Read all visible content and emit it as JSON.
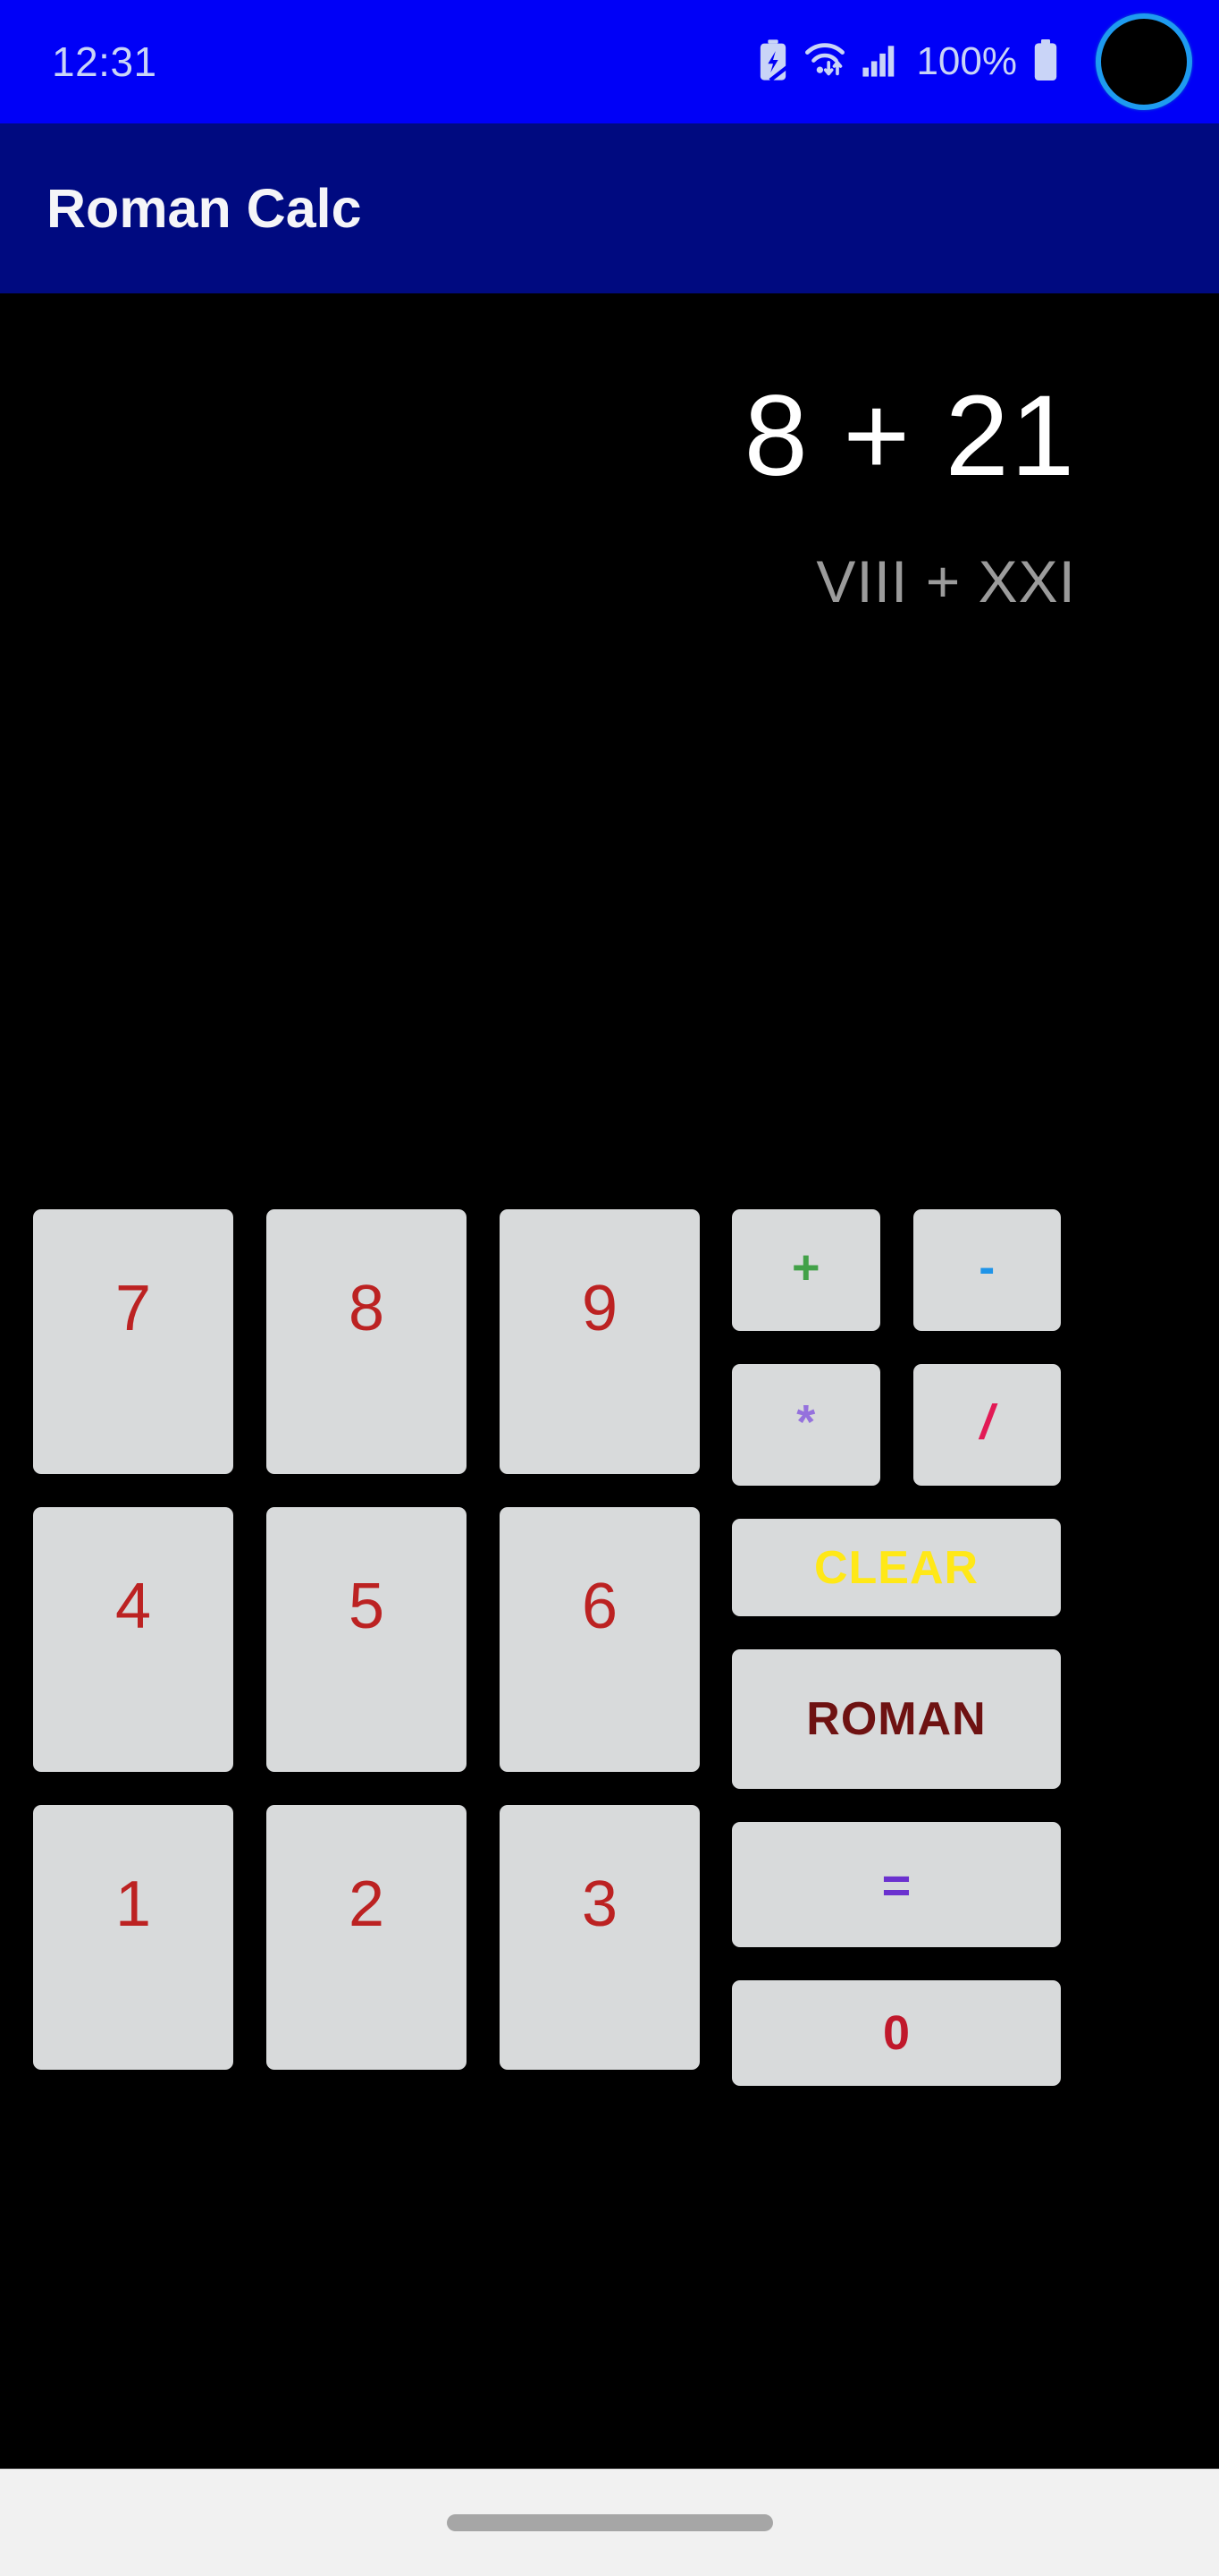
{
  "status_bar": {
    "time": "12:31",
    "battery_percent": "100%",
    "icons": [
      "battery-saver-icon",
      "wifi-data-icon",
      "cellular-signal-icon",
      "battery-icon"
    ],
    "background_color": "#0000f7",
    "text_color": "#c9d4f7",
    "punch_hole_ring_color": "#1e9bf0"
  },
  "app_bar": {
    "title": "Roman Calc",
    "background_color": "#000a80",
    "title_color": "#f5f5f8"
  },
  "display": {
    "primary": "8 + 21",
    "secondary": "VIII + XXI",
    "primary_color": "#ffffff",
    "secondary_color": "#9b9b9b",
    "background_color": "#000000"
  },
  "keypad": {
    "button_background": "#d8dadb",
    "digits": [
      {
        "label": "7",
        "name": "key-7",
        "color": "#bc2222"
      },
      {
        "label": "8",
        "name": "key-8",
        "color": "#bc2222"
      },
      {
        "label": "9",
        "name": "key-9",
        "color": "#bc2222"
      },
      {
        "label": "4",
        "name": "key-4",
        "color": "#bc2222"
      },
      {
        "label": "5",
        "name": "key-5",
        "color": "#bc2222"
      },
      {
        "label": "6",
        "name": "key-6",
        "color": "#bc2222"
      },
      {
        "label": "1",
        "name": "key-1",
        "color": "#bc2222"
      },
      {
        "label": "2",
        "name": "key-2",
        "color": "#bc2222"
      },
      {
        "label": "3",
        "name": "key-3",
        "color": "#bc2222"
      }
    ],
    "operators": [
      {
        "label": "+",
        "name": "key-plus",
        "color": "#42a148"
      },
      {
        "label": "-",
        "name": "key-minus",
        "color": "#1f94e8"
      },
      {
        "label": "*",
        "name": "key-multiply",
        "color": "#9571dd"
      },
      {
        "label": "/",
        "name": "key-divide",
        "color": "#e21a55"
      }
    ],
    "clear": {
      "label": "CLEAR",
      "color": "#ffe817"
    },
    "roman": {
      "label": "ROMAN",
      "color": "#6e1212"
    },
    "equals": {
      "label": "=",
      "color": "#6b31cf"
    },
    "zero": {
      "label": "0",
      "color": "#c0182b"
    }
  },
  "nav_bar": {
    "background_color": "#f1f1f1",
    "pill_color": "#a6a6a6"
  }
}
